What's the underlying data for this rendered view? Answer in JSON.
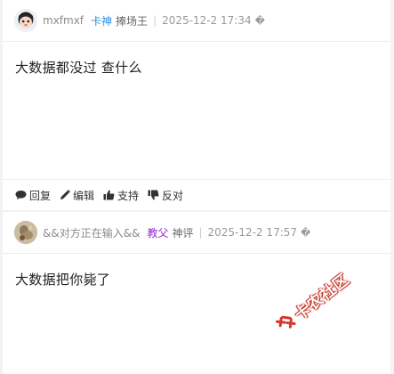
{
  "posts": [
    {
      "username": "mxfmxf",
      "badge": "卡神",
      "title": "捧场王",
      "time": "2025-12-2 17:34",
      "time_icon": "�",
      "content": "大数据都没过  查什么",
      "avatar_color": "#e9eef3"
    },
    {
      "username": "&&对方正在输入&&",
      "badge": "教父",
      "title": "神评",
      "time": "2025-12-2 17:57",
      "time_icon": "�",
      "content": "大数据把你毙了",
      "avatar_color": "#b8a58a"
    }
  ],
  "actions": {
    "reply": "回复",
    "edit": "编辑",
    "support": "支持",
    "oppose": "反对"
  },
  "watermark": {
    "text": "卡农社区",
    "color": "#d9362b"
  }
}
